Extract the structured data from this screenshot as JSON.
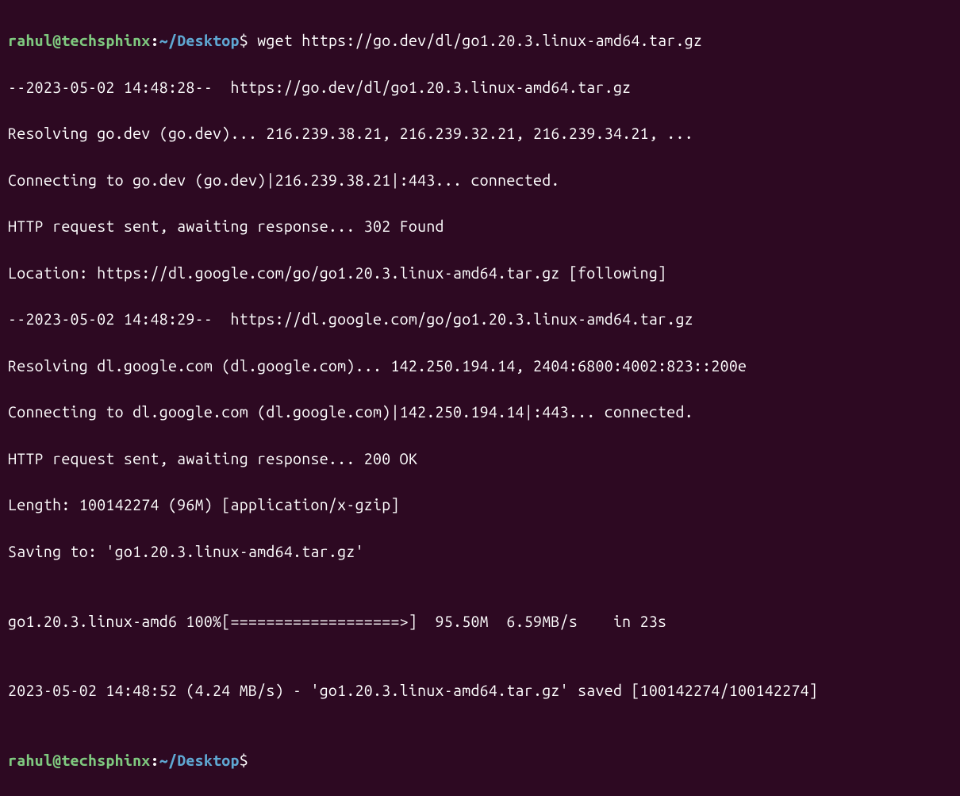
{
  "prompt1": {
    "user": "rahul@techsphinx",
    "colon": ":",
    "path": "~/Desktop",
    "dollar": "$",
    "command": " wget https://go.dev/dl/go1.20.3.linux-amd64.tar.gz"
  },
  "output": {
    "l1": "--2023-05-02 14:48:28--  https://go.dev/dl/go1.20.3.linux-amd64.tar.gz",
    "l2": "Resolving go.dev (go.dev)... 216.239.38.21, 216.239.32.21, 216.239.34.21, ...",
    "l3": "Connecting to go.dev (go.dev)|216.239.38.21|:443... connected.",
    "l4": "HTTP request sent, awaiting response... 302 Found",
    "l5": "Location: https://dl.google.com/go/go1.20.3.linux-amd64.tar.gz [following]",
    "l6": "--2023-05-02 14:48:29--  https://dl.google.com/go/go1.20.3.linux-amd64.tar.gz",
    "l7": "Resolving dl.google.com (dl.google.com)... 142.250.194.14, 2404:6800:4002:823::200e",
    "l8": "Connecting to dl.google.com (dl.google.com)|142.250.194.14|:443... connected.",
    "l9": "HTTP request sent, awaiting response... 200 OK",
    "l10": "Length: 100142274 (96M) [application/x-gzip]",
    "l11": "Saving to: 'go1.20.3.linux-amd64.tar.gz'",
    "l12": "",
    "l13": "go1.20.3.linux-amd6 100%[===================>]  95.50M  6.59MB/s    in 23s",
    "l14": "",
    "l15": "2023-05-02 14:48:52 (4.24 MB/s) - 'go1.20.3.linux-amd64.tar.gz' saved [100142274/100142274]",
    "l16": ""
  },
  "prompt2": {
    "user": "rahul@techsphinx",
    "colon": ":",
    "path": "~/Desktop",
    "dollar": "$"
  }
}
